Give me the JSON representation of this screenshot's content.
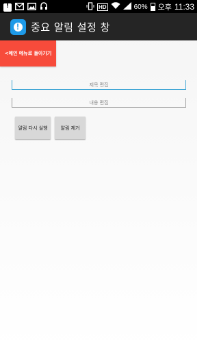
{
  "status_bar": {
    "icons": [
      "notification-alert-icon",
      "mail-icon",
      "image-icon",
      "headset-icon"
    ],
    "right_icons": [
      "vibrate-icon",
      "hd-icon",
      "wifi-icon",
      "signal-icon"
    ],
    "hd_label": "HD",
    "battery_percent": "60%",
    "ampm": "오후",
    "time": "11:33"
  },
  "action_bar": {
    "title": "중요 알림 설정 창",
    "icon": "alert-app-icon",
    "accent": "#1e9ae8"
  },
  "back_button": {
    "label": "<메인 메뉴로 돌아가기",
    "color": "#f74b3b"
  },
  "fields": {
    "title_placeholder": "제목 편집",
    "content_placeholder": "내용 편집"
  },
  "buttons": {
    "rerun_label": "알림 다시 실행",
    "remove_label": "알림 제거"
  }
}
